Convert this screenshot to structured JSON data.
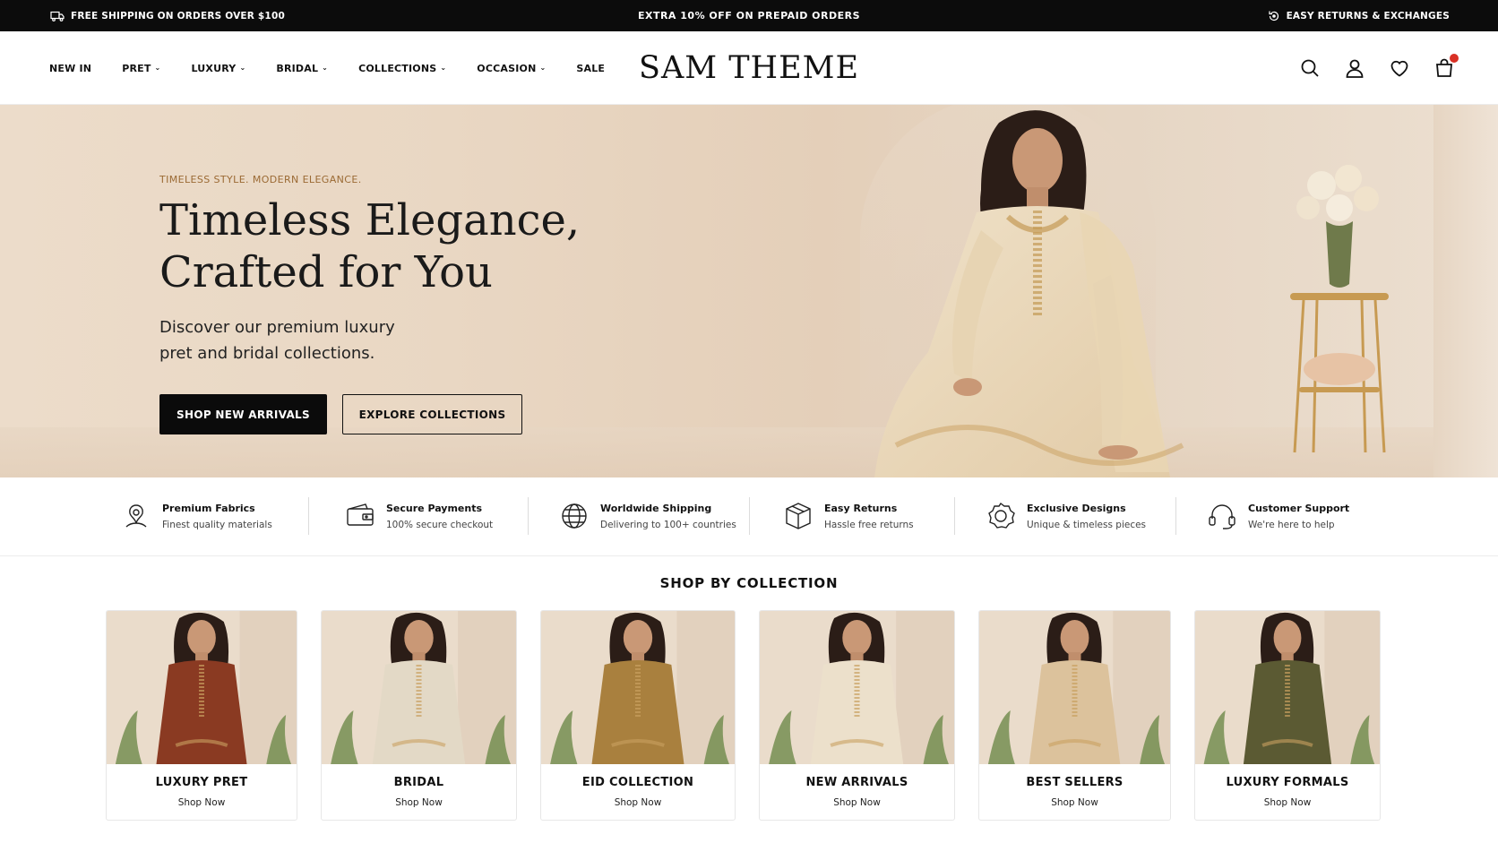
{
  "topbar": {
    "left_text": "FREE SHIPPING ON ORDERS OVER $100",
    "left_icon": "truck-icon",
    "center_text": "EXTRA 10% OFF ON PREPAID ORDERS",
    "right_text": "EASY RETURNS & EXCHANGES",
    "right_icon": "return-icon"
  },
  "header": {
    "nav": [
      {
        "label": "NEW IN",
        "has_dropdown": false
      },
      {
        "label": "PRET",
        "has_dropdown": true
      },
      {
        "label": "LUXURY",
        "has_dropdown": true
      },
      {
        "label": "BRIDAL",
        "has_dropdown": true
      },
      {
        "label": "COLLECTIONS",
        "has_dropdown": true
      },
      {
        "label": "OCCASION",
        "has_dropdown": true
      },
      {
        "label": "SALE",
        "has_dropdown": false
      }
    ],
    "logo": "SAM THEME",
    "icons": [
      "search-icon",
      "account-icon",
      "wishlist-icon",
      "cart-icon"
    ],
    "cart_count": ""
  },
  "hero": {
    "tagline": "TIMELESS STYLE. MODERN ELEGANCE.",
    "title_line1": "Timeless Elegance,",
    "title_line2": "Crafted for You",
    "subtitle_line1": "Discover our premium luxury",
    "subtitle_line2": "pret and bridal collections.",
    "primary_button": "SHOP NEW ARRIVALS",
    "secondary_button": "EXPLORE COLLECTIONS",
    "accent_color": "#9b6a34"
  },
  "features": [
    {
      "icon": "fabric-icon",
      "title": "Premium Fabrics",
      "desc": "Finest quality materials"
    },
    {
      "icon": "wallet-icon",
      "title": "Secure Payments",
      "desc": "100% secure checkout"
    },
    {
      "icon": "globe-icon",
      "title": "Worldwide Shipping",
      "desc": "Delivering to 100+ countries"
    },
    {
      "icon": "box-icon",
      "title": "Easy Returns",
      "desc": "Hassle free returns"
    },
    {
      "icon": "badge-icon",
      "title": "Exclusive Designs",
      "desc": "Unique & timeless pieces"
    },
    {
      "icon": "headset-icon",
      "title": "Customer Support",
      "desc": "We're here to help"
    }
  ],
  "collections": {
    "title": "SHOP BY COLLECTION",
    "items": [
      {
        "name": "LUXURY PRET",
        "cta": "Shop Now",
        "dress_color": "#8a3a22"
      },
      {
        "name": "BRIDAL",
        "cta": "Shop Now",
        "dress_color": "#e3d9c6"
      },
      {
        "name": "EID COLLECTION",
        "cta": "Shop Now",
        "dress_color": "#a9803e"
      },
      {
        "name": "NEW ARRIVALS",
        "cta": "Shop Now",
        "dress_color": "#ece0cb"
      },
      {
        "name": "BEST SELLERS",
        "cta": "Shop Now",
        "dress_color": "#dcc29c"
      },
      {
        "name": "LUXURY FORMALS",
        "cta": "Shop Now",
        "dress_color": "#5b5a33"
      }
    ]
  }
}
